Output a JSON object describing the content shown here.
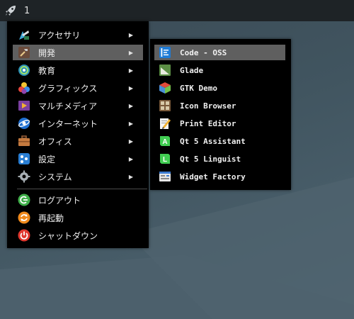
{
  "panel": {
    "launcher_icon": "rocket-icon",
    "workspace_number": "1"
  },
  "menu": {
    "items": [
      {
        "label": "アクセサリ",
        "icon": "accessories-icon",
        "has_submenu": true
      },
      {
        "label": "開発",
        "icon": "development-icon",
        "has_submenu": true,
        "active": true
      },
      {
        "label": "教育",
        "icon": "education-icon",
        "has_submenu": true
      },
      {
        "label": "グラフィックス",
        "icon": "graphics-icon",
        "has_submenu": true
      },
      {
        "label": "マルチメディア",
        "icon": "multimedia-icon",
        "has_submenu": true
      },
      {
        "label": "インターネット",
        "icon": "internet-icon",
        "has_submenu": true
      },
      {
        "label": "オフィス",
        "icon": "office-icon",
        "has_submenu": true
      },
      {
        "label": "設定",
        "icon": "settings-icon",
        "has_submenu": true
      },
      {
        "label": "システム",
        "icon": "system-icon",
        "has_submenu": true
      }
    ],
    "session": [
      {
        "label": "ログアウト",
        "icon": "logout-icon"
      },
      {
        "label": "再起動",
        "icon": "reboot-icon"
      },
      {
        "label": "シャットダウン",
        "icon": "shutdown-icon"
      }
    ],
    "arrow": "▶"
  },
  "submenu": {
    "items": [
      {
        "label": "Code - OSS",
        "icon": "code-oss-icon",
        "active": true
      },
      {
        "label": "Glade",
        "icon": "glade-icon"
      },
      {
        "label": "GTK Demo",
        "icon": "gtk-demo-icon"
      },
      {
        "label": "Icon Browser",
        "icon": "icon-browser-icon"
      },
      {
        "label": "Print Editor",
        "icon": "print-editor-icon"
      },
      {
        "label": "Qt 5 Assistant",
        "icon": "qt-assistant-icon"
      },
      {
        "label": "Qt 5 Linguist",
        "icon": "qt-linguist-icon"
      },
      {
        "label": "Widget Factory",
        "icon": "widget-factory-icon"
      }
    ]
  },
  "colors": {
    "menu_bg": "#000000",
    "highlight": "#5f5f5f",
    "panel_bg": "#1e2326",
    "text": "#f0f0f0"
  }
}
